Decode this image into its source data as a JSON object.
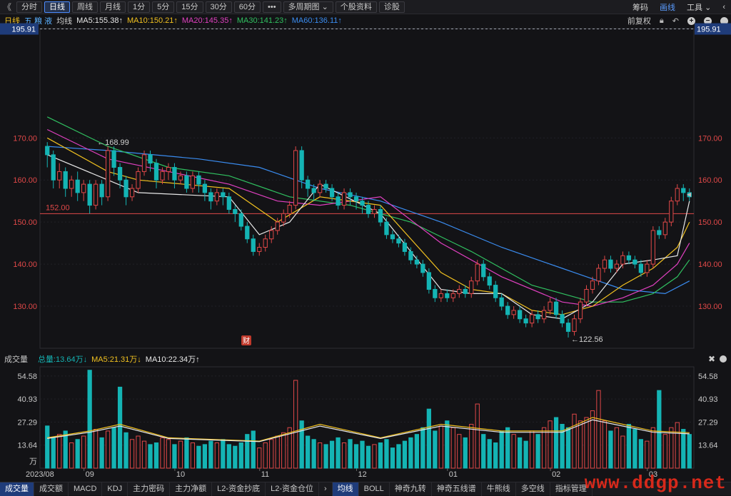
{
  "toolbar": {
    "back": "《",
    "periods": [
      "分时",
      "日线",
      "周线",
      "月线",
      "1分",
      "5分",
      "15分",
      "30分",
      "60分",
      "•••",
      "多周期图 ⌄",
      "个股资料",
      "诊股"
    ],
    "active_period": "日线",
    "right_items": [
      "筹码",
      "画线",
      "工具 ⌄",
      "‹"
    ]
  },
  "main_legend": {
    "kline": "日线",
    "wudang": "五 粮 液",
    "junxian": "均线",
    "ma5": "MA5:155.38↑",
    "ma10": "MA10:150.21↑",
    "ma20": "MA20:145.35↑",
    "ma30": "MA30:141.23↑",
    "ma60": "MA60:136.11↑",
    "fuquan": "前复权"
  },
  "colors": {
    "up": "#e04848",
    "down": "#14b4b4",
    "ma5": "#e8e8e8",
    "ma10": "#f0c020",
    "ma20": "#e040c0",
    "ma30": "#30c060",
    "ma60": "#3a8cf0",
    "accent": "#4c8cff"
  },
  "price_axis": {
    "ticks": [
      "170.00",
      "160.00",
      "150.00",
      "140.00",
      "130.00"
    ],
    "current": "195.91",
    "hline": "152.00",
    "max_label": "←168.99",
    "min_label": "←122.56",
    "marker": "财"
  },
  "vol_legend": {
    "title": "成交量",
    "total": "总量:13.64万↓",
    "ma5": "MA5:21.31万↓",
    "ma10": "MA10:22.34万↑"
  },
  "vol_axis": {
    "ticks": [
      "54.58",
      "40.93",
      "27.29",
      "13.64",
      "万"
    ]
  },
  "date_axis": [
    "2023/08",
    "09",
    "10",
    "11",
    "12",
    "01",
    "02",
    "03"
  ],
  "bottom_tabs": [
    "成交量",
    "成交额",
    "MACD",
    "KDJ",
    "主力密码",
    "主力净额",
    "L2-资金抄底",
    "L2-资金仓位",
    "›",
    "均线",
    "BOLL",
    "神奇九转",
    "神奇五线谱",
    "牛熊线",
    "多空线",
    "指标管理"
  ],
  "active_tabs": [
    "成交量",
    "均线"
  ],
  "watermark": "www.ddgp.net",
  "chart_data": {
    "type": "candlestick",
    "price_range": [
      120,
      196
    ],
    "volume_range": [
      0,
      60
    ],
    "candles": [
      [
        168,
        166,
        169,
        163
      ],
      [
        166,
        160,
        167,
        158
      ],
      [
        160,
        162,
        164,
        158
      ],
      [
        162,
        158,
        163,
        156
      ],
      [
        158,
        160,
        161,
        156
      ],
      [
        160,
        157,
        162,
        155
      ],
      [
        157,
        159,
        160,
        155
      ],
      [
        159,
        154,
        160,
        152
      ],
      [
        154,
        159,
        160,
        153
      ],
      [
        159,
        156,
        160,
        154
      ],
      [
        156,
        167,
        168,
        155
      ],
      [
        167,
        163,
        168,
        161
      ],
      [
        163,
        160,
        164,
        158
      ],
      [
        160,
        156,
        161,
        154
      ],
      [
        156,
        158,
        159,
        155
      ],
      [
        158,
        162,
        163,
        157
      ],
      [
        162,
        166,
        167,
        161
      ],
      [
        166,
        164,
        167,
        162
      ],
      [
        164,
        160,
        165,
        158
      ],
      [
        160,
        162,
        163,
        159
      ],
      [
        162,
        163,
        164,
        160
      ],
      [
        163,
        160,
        164,
        158
      ],
      [
        160,
        161,
        162,
        159
      ],
      [
        161,
        158,
        162,
        157
      ],
      [
        158,
        161,
        162,
        157
      ],
      [
        161,
        159,
        162,
        157
      ],
      [
        159,
        157,
        160,
        155
      ],
      [
        157,
        155,
        158,
        153
      ],
      [
        155,
        157,
        158,
        154
      ],
      [
        157,
        156,
        158,
        154
      ],
      [
        156,
        153,
        157,
        152
      ],
      [
        153,
        152,
        154,
        150
      ],
      [
        152,
        149,
        153,
        148
      ],
      [
        149,
        146,
        150,
        145
      ],
      [
        146,
        143,
        147,
        142
      ],
      [
        143,
        144,
        145,
        142
      ],
      [
        144,
        146,
        147,
        143
      ],
      [
        146,
        148,
        149,
        145
      ],
      [
        148,
        150,
        151,
        147
      ],
      [
        150,
        152,
        153,
        149
      ],
      [
        152,
        154,
        155,
        151
      ],
      [
        154,
        167,
        168,
        153
      ],
      [
        167,
        160,
        168,
        158
      ],
      [
        160,
        158,
        161,
        156
      ],
      [
        158,
        157,
        159,
        155
      ],
      [
        157,
        159,
        160,
        156
      ],
      [
        159,
        158,
        160,
        157
      ],
      [
        158,
        156,
        159,
        155
      ],
      [
        156,
        154,
        157,
        153
      ],
      [
        154,
        157,
        158,
        153
      ],
      [
        157,
        156,
        158,
        154
      ],
      [
        156,
        155,
        157,
        153
      ],
      [
        155,
        154,
        156,
        152
      ],
      [
        154,
        152,
        155,
        151
      ],
      [
        152,
        153,
        154,
        151
      ],
      [
        153,
        150,
        154,
        149
      ],
      [
        150,
        147,
        151,
        146
      ],
      [
        147,
        146,
        148,
        145
      ],
      [
        146,
        145,
        147,
        144
      ],
      [
        145,
        143,
        146,
        142
      ],
      [
        143,
        141,
        144,
        140
      ],
      [
        141,
        140,
        142,
        139
      ],
      [
        140,
        138,
        141,
        137
      ],
      [
        138,
        134,
        139,
        133
      ],
      [
        134,
        132,
        135,
        131
      ],
      [
        132,
        133,
        134,
        131
      ],
      [
        133,
        132,
        134,
        131
      ],
      [
        132,
        133,
        134,
        131
      ],
      [
        133,
        134,
        135,
        132
      ],
      [
        134,
        133,
        135,
        132
      ],
      [
        133,
        136,
        137,
        132
      ],
      [
        136,
        140,
        141,
        135
      ],
      [
        140,
        137,
        141,
        136
      ],
      [
        137,
        135,
        138,
        134
      ],
      [
        135,
        132,
        136,
        131
      ],
      [
        132,
        130,
        133,
        129
      ],
      [
        130,
        128,
        131,
        127
      ],
      [
        128,
        129,
        130,
        127
      ],
      [
        129,
        127,
        130,
        126
      ],
      [
        127,
        126,
        128,
        125
      ],
      [
        126,
        128,
        129,
        125
      ],
      [
        128,
        127,
        129,
        126
      ],
      [
        127,
        129,
        130,
        126
      ],
      [
        129,
        131,
        132,
        128
      ],
      [
        131,
        128,
        132,
        127
      ],
      [
        128,
        126,
        129,
        125
      ],
      [
        126,
        124,
        127,
        122.56
      ],
      [
        124,
        127,
        128,
        123
      ],
      [
        127,
        131,
        132,
        126
      ],
      [
        131,
        134,
        135,
        130
      ],
      [
        134,
        136,
        137,
        133
      ],
      [
        136,
        139,
        140,
        135
      ],
      [
        139,
        141,
        142,
        138
      ],
      [
        141,
        139,
        142,
        138
      ],
      [
        139,
        140,
        141,
        138
      ],
      [
        140,
        142,
        143,
        139
      ],
      [
        142,
        141,
        143,
        140
      ],
      [
        141,
        140,
        142,
        139
      ],
      [
        140,
        138,
        141,
        137
      ],
      [
        138,
        140,
        141,
        137
      ],
      [
        140,
        148,
        149,
        139
      ],
      [
        148,
        147,
        149,
        146
      ],
      [
        147,
        150,
        151,
        146
      ],
      [
        150,
        155,
        156,
        149
      ],
      [
        155,
        158,
        159,
        154
      ],
      [
        158,
        157,
        159,
        155
      ],
      [
        157,
        156,
        158,
        155
      ]
    ],
    "ma_series": {
      "ma5": [
        [
          0,
          166
        ],
        [
          10,
          160
        ],
        [
          15,
          157
        ],
        [
          30,
          156
        ],
        [
          35,
          147
        ],
        [
          40,
          150
        ],
        [
          45,
          159
        ],
        [
          55,
          152
        ],
        [
          65,
          134
        ],
        [
          70,
          133
        ],
        [
          75,
          133
        ],
        [
          80,
          128
        ],
        [
          85,
          127
        ],
        [
          90,
          131
        ],
        [
          95,
          140
        ],
        [
          100,
          141
        ],
        [
          104,
          142
        ],
        [
          106,
          155
        ]
      ],
      "ma10": [
        [
          0,
          170
        ],
        [
          10,
          162
        ],
        [
          15,
          160
        ],
        [
          30,
          158
        ],
        [
          38,
          150
        ],
        [
          45,
          156
        ],
        [
          55,
          154
        ],
        [
          65,
          138
        ],
        [
          70,
          134
        ],
        [
          75,
          133
        ],
        [
          80,
          129
        ],
        [
          85,
          128
        ],
        [
          90,
          130
        ],
        [
          95,
          135
        ],
        [
          100,
          139
        ],
        [
          104,
          144
        ],
        [
          106,
          150
        ]
      ],
      "ma20": [
        [
          0,
          172
        ],
        [
          10,
          165
        ],
        [
          20,
          162
        ],
        [
          30,
          159
        ],
        [
          38,
          155
        ],
        [
          45,
          154
        ],
        [
          55,
          156
        ],
        [
          65,
          145
        ],
        [
          75,
          137
        ],
        [
          85,
          131
        ],
        [
          90,
          130
        ],
        [
          95,
          132
        ],
        [
          100,
          135
        ],
        [
          104,
          140
        ],
        [
          106,
          145
        ]
      ],
      "ma30": [
        [
          0,
          175
        ],
        [
          10,
          168
        ],
        [
          20,
          163
        ],
        [
          30,
          161
        ],
        [
          40,
          156
        ],
        [
          50,
          154
        ],
        [
          60,
          150
        ],
        [
          70,
          143
        ],
        [
          80,
          135
        ],
        [
          90,
          131
        ],
        [
          95,
          131
        ],
        [
          100,
          133
        ],
        [
          104,
          137
        ],
        [
          106,
          141
        ]
      ],
      "ma60": [
        [
          0,
          168
        ],
        [
          10,
          167
        ],
        [
          25,
          165
        ],
        [
          35,
          163
        ],
        [
          45,
          158
        ],
        [
          55,
          155
        ],
        [
          65,
          150
        ],
        [
          75,
          144
        ],
        [
          85,
          139
        ],
        [
          95,
          134
        ],
        [
          102,
          133
        ],
        [
          106,
          136
        ]
      ]
    },
    "volumes": [
      25,
      18,
      20,
      22,
      15,
      17,
      19,
      58,
      23,
      18,
      22,
      24,
      48,
      21,
      17,
      19,
      16,
      14,
      15,
      18,
      17,
      14,
      16,
      18,
      15,
      13,
      14,
      16,
      15,
      17,
      14,
      13,
      15,
      20,
      22,
      12,
      15,
      17,
      19,
      21,
      24,
      52,
      28,
      19,
      17,
      15,
      14,
      16,
      18,
      15,
      17,
      14,
      16,
      13,
      14,
      15,
      17,
      12,
      14,
      16,
      18,
      20,
      24,
      35,
      22,
      25,
      28,
      24,
      20,
      18,
      26,
      38,
      20,
      17,
      15,
      22,
      24,
      20,
      18,
      16,
      22,
      20,
      24,
      28,
      30,
      26,
      24,
      32,
      28,
      30,
      34,
      46,
      28,
      22,
      24,
      19,
      26,
      23,
      17,
      16,
      24,
      46,
      20,
      24,
      27,
      23,
      20
    ],
    "vol_ma": [
      [
        0,
        18
      ],
      [
        7,
        22
      ],
      [
        12,
        26
      ],
      [
        20,
        18
      ],
      [
        35,
        16
      ],
      [
        45,
        26
      ],
      [
        55,
        18
      ],
      [
        65,
        26
      ],
      [
        75,
        22
      ],
      [
        85,
        22
      ],
      [
        90,
        30
      ],
      [
        95,
        26
      ],
      [
        100,
        22
      ],
      [
        106,
        21
      ]
    ]
  }
}
